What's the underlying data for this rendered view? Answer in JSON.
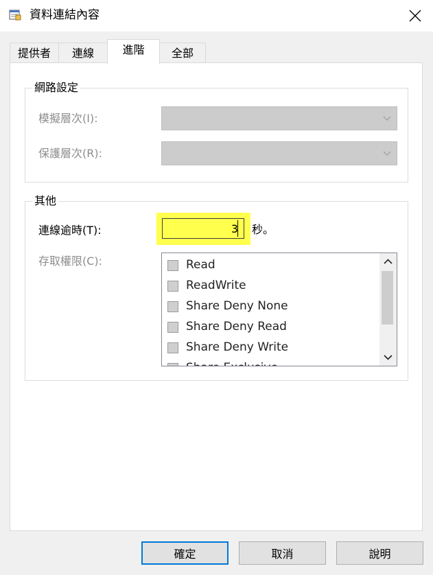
{
  "window": {
    "title": "資料連結內容",
    "icon": "data-link-icon",
    "close_icon": "close-icon"
  },
  "tabs": [
    {
      "label": "提供者",
      "active": false
    },
    {
      "label": "連線",
      "active": false
    },
    {
      "label": "進階",
      "active": true
    },
    {
      "label": "全部",
      "active": false
    }
  ],
  "network_group": {
    "title": "網路設定",
    "impersonation_label": "模擬層次(I):",
    "protection_label": "保護層次(R):"
  },
  "other_group": {
    "title": "其他",
    "timeout_label": "連線逾時(T):",
    "timeout_value": "3",
    "timeout_unit": "秒。",
    "access_label": "存取權限(C):",
    "access_items": [
      "Read",
      "ReadWrite",
      "Share Deny None",
      "Share Deny Read",
      "Share Deny Write",
      "Share Exclusive"
    ]
  },
  "buttons": {
    "ok": "確定",
    "cancel": "取消",
    "help": "說明"
  },
  "colors": {
    "highlight": "#ffff4d",
    "default_button_border": "#0078d7"
  }
}
